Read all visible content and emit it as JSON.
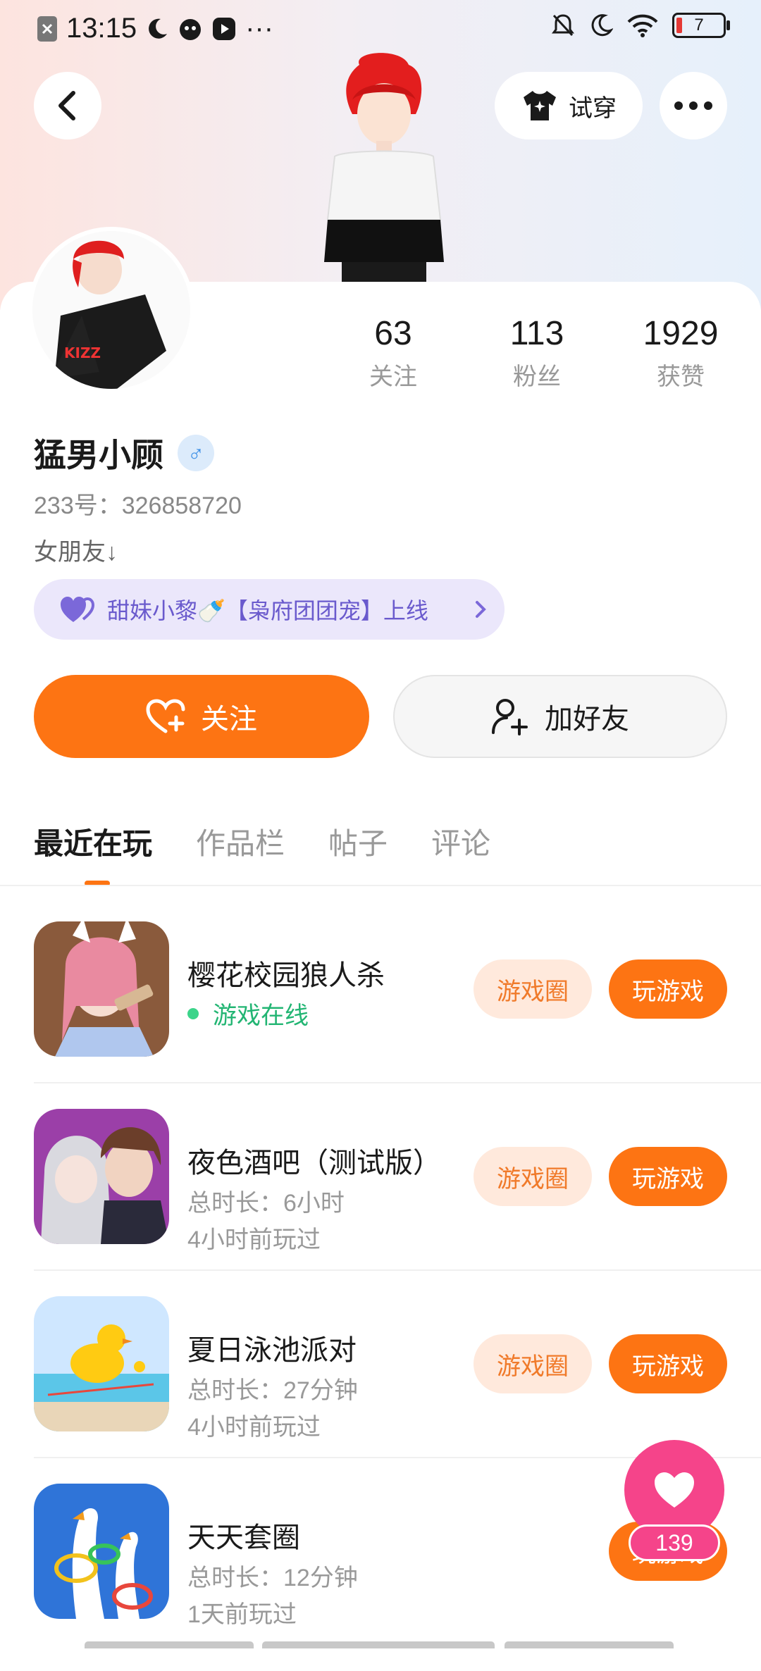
{
  "status_bar": {
    "time": "13:15",
    "more": "···",
    "battery": "7"
  },
  "header": {
    "tryon_label": "试穿"
  },
  "profile": {
    "stats": [
      {
        "value": "63",
        "label": "关注"
      },
      {
        "value": "113",
        "label": "粉丝"
      },
      {
        "value": "1929",
        "label": "获赞"
      }
    ],
    "name": "猛男小顾",
    "gender_symbol": "♂",
    "uid": "233号：326858720",
    "bio": "女朋友↓",
    "cp_text": "甜妹小黎🍼【枭府团团宠】上线"
  },
  "actions": {
    "follow": "关注",
    "add_friend": "加好友"
  },
  "tabs": [
    "最近在玩",
    "作品栏",
    "帖子",
    "评论"
  ],
  "games": [
    {
      "title": "樱花校园狼人杀",
      "line2": "游戏在线",
      "line3": "",
      "online": true,
      "circle": "游戏圈",
      "play": "玩游戏"
    },
    {
      "title": "夜色酒吧（测试版）",
      "line2": "总时长：6小时",
      "line3": "4小时前玩过",
      "online": false,
      "circle": "游戏圈",
      "play": "玩游戏"
    },
    {
      "title": "夏日泳池派对",
      "line2": "总时长：27分钟",
      "line3": "4小时前玩过",
      "online": false,
      "circle": "游戏圈",
      "play": "玩游戏"
    },
    {
      "title": "天天套圈",
      "line2": "总时长：12分钟",
      "line3": "1天前玩过",
      "online": false,
      "circle": "",
      "play": "玩游戏"
    }
  ],
  "fab": {
    "count": "139"
  },
  "colors": {
    "accent": "#fd7413",
    "pink": "#f5448a",
    "online_green": "#22b573",
    "cp_purple": "#6a5acd"
  }
}
